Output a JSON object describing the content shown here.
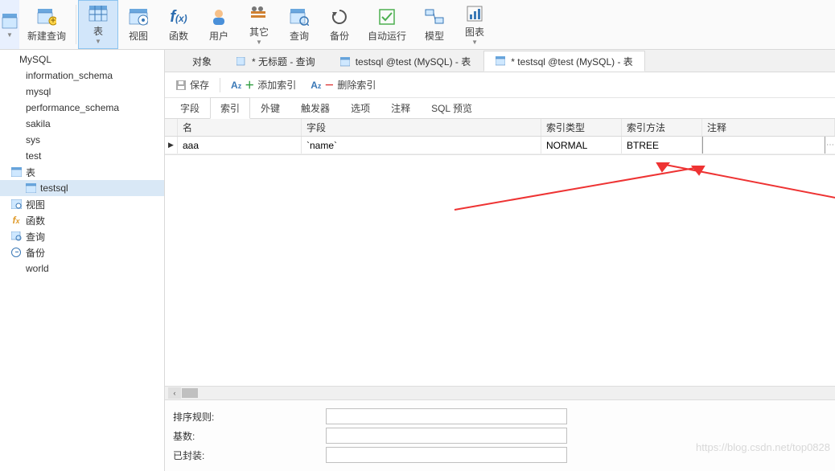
{
  "toolbar": {
    "new_query": "新建查询",
    "table": "表",
    "view": "视图",
    "function": "函数",
    "user": "用户",
    "other": "其它",
    "query": "查询",
    "backup": "备份",
    "autorun": "自动运行",
    "model": "模型",
    "chart": "图表"
  },
  "sidebar": {
    "items": [
      {
        "label": "MySQL",
        "level": 1,
        "icon": "db"
      },
      {
        "label": "information_schema",
        "level": 2,
        "icon": "db"
      },
      {
        "label": "mysql",
        "level": 2,
        "icon": "db"
      },
      {
        "label": "performance_schema",
        "level": 2,
        "icon": "db"
      },
      {
        "label": "sakila",
        "level": 2,
        "icon": "db"
      },
      {
        "label": "sys",
        "level": 2,
        "icon": "db"
      },
      {
        "label": "test",
        "level": 2,
        "icon": "db"
      },
      {
        "label": "表",
        "level": 2,
        "icon": "table"
      },
      {
        "label": "testsql",
        "level": 3,
        "icon": "table",
        "selected": true
      },
      {
        "label": "视图",
        "level": 2,
        "icon": "view"
      },
      {
        "label": "函数",
        "level": 2,
        "icon": "fx"
      },
      {
        "label": "查询",
        "level": 2,
        "icon": "query"
      },
      {
        "label": "备份",
        "level": 2,
        "icon": "backup"
      },
      {
        "label": "world",
        "level": 2,
        "icon": "db"
      }
    ]
  },
  "tabs": [
    {
      "label": "对象",
      "icon": "none"
    },
    {
      "label": "* 无标题 - 查询",
      "icon": "query"
    },
    {
      "label": "testsql @test (MySQL) - 表",
      "icon": "table"
    },
    {
      "label": "* testsql @test (MySQL) - 表",
      "icon": "tableedit",
      "active": true
    }
  ],
  "actions": {
    "save": "保存",
    "add_index": "添加索引",
    "delete_index": "删除索引"
  },
  "subtabs": [
    "字段",
    "索引",
    "外键",
    "触发器",
    "选项",
    "注释",
    "SQL 预览"
  ],
  "subtab_active": 1,
  "grid": {
    "headers": [
      "名",
      "字段",
      "索引类型",
      "索引方法",
      "注释"
    ],
    "rows": [
      {
        "name": "aaa",
        "field": "`name`",
        "type": "NORMAL",
        "method": "BTREE",
        "comment": ""
      }
    ]
  },
  "props": {
    "collation_label": "排序规则:",
    "cardinality_label": "基数:",
    "packed_label": "已封装:"
  },
  "watermark": "https://blog.csdn.net/top0828"
}
